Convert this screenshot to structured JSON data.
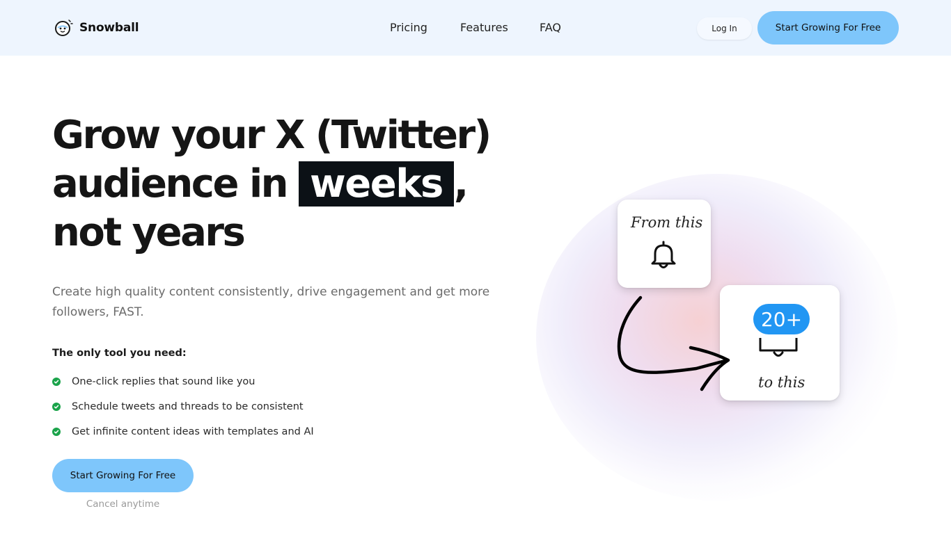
{
  "header": {
    "brand": "Snowball",
    "nav": [
      "Pricing",
      "Features",
      "FAQ"
    ],
    "login_label": "Log In",
    "cta_label": "Start Growing For Free"
  },
  "hero": {
    "headline": {
      "line1": "Grow your X (Twitter)",
      "line2_prefix": "audience in",
      "highlight": "weeks",
      "line2_suffix": ",",
      "line3": "not years"
    },
    "subtitle": "Create high quality content consistently, drive engagement and get more followers, FAST.",
    "tool_heading": "The only tool you need:",
    "features": [
      "One-click replies that sound like you",
      "Schedule tweets and threads to be consistent",
      "Get infinite content ideas with templates and AI"
    ],
    "cta_label": "Start Growing For Free",
    "cancel_note": "Cancel anytime"
  },
  "illustration": {
    "from_label": "From this",
    "to_label": "to this",
    "badge_count": "20+",
    "icons": [
      "bell-icon",
      "bell-with-badge-icon",
      "curved-arrow-icon",
      "check-icon"
    ]
  },
  "colors": {
    "header_bg": "#eef5fe",
    "cta_bg": "#7ec6fb",
    "highlight_bg": "#0c1116",
    "check_green": "#1aa34a",
    "badge_blue": "#2196f3"
  }
}
